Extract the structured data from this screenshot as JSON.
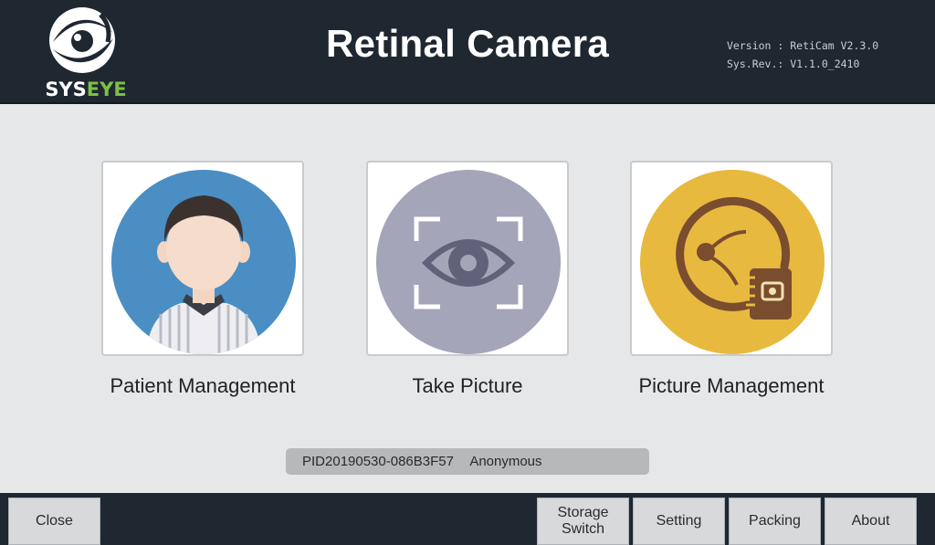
{
  "header": {
    "logo_text_a": "SYS",
    "logo_text_b": "EYE",
    "title": "Retinal Camera",
    "version_line": "Version : RetiCam V2.3.0",
    "sysrev_line": "Sys.Rev.: V1.1.0_2410"
  },
  "tiles": [
    {
      "label": "Patient Management",
      "icon": "patient-icon",
      "color": "#4a8ec4"
    },
    {
      "label": "Take Picture",
      "icon": "eye-scan-icon",
      "color": "#a4a5b9"
    },
    {
      "label": "Picture Management",
      "icon": "picture-folder-icon",
      "color": "#e8b93f"
    }
  ],
  "patient": {
    "pid": "PID20190530-086B3F57",
    "name": "Anonymous"
  },
  "footer": {
    "close": "Close",
    "storage_switch_1": "Storage",
    "storage_switch_2": "Switch",
    "setting": "Setting",
    "packing": "Packing",
    "about": "About"
  },
  "colors": {
    "header_bg": "#1f2731",
    "page_bg": "#e6e7e8",
    "logo_accent": "#7bc043"
  }
}
